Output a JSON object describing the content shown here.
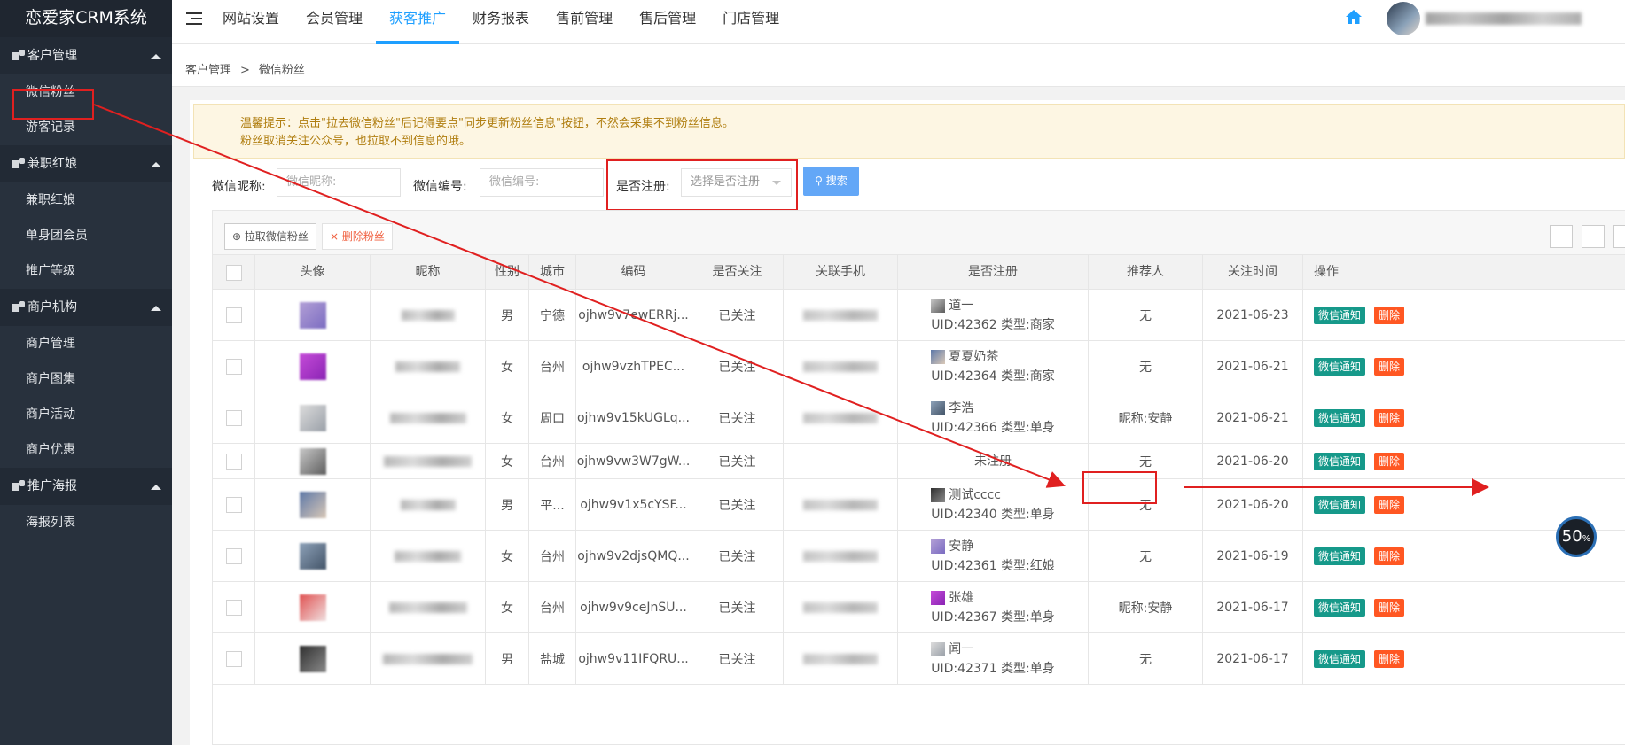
{
  "app": {
    "title": "恋爱家CRM系统"
  },
  "sidebar": {
    "groups": [
      {
        "label": "客户管理",
        "items": [
          "微信粉丝",
          "游客记录"
        ]
      },
      {
        "label": "兼职红娘",
        "items": [
          "兼职红娘",
          "单身团会员",
          "推广等级"
        ]
      },
      {
        "label": "商户机构",
        "items": [
          "商户管理",
          "商户图集",
          "商户活动",
          "商户优惠"
        ]
      },
      {
        "label": "推广海报",
        "items": [
          "海报列表"
        ]
      }
    ]
  },
  "topnav": {
    "items": [
      "网站设置",
      "会员管理",
      "获客推广",
      "财务报表",
      "售前管理",
      "售后管理",
      "门店管理"
    ],
    "active": "获客推广"
  },
  "breadcrumb": {
    "root": "客户管理",
    "sep": ">",
    "current": "微信粉丝"
  },
  "tip": {
    "line1": "温馨提示：点击\"拉去微信粉丝\"后记得要点\"同步更新粉丝信息\"按钮，不然会采集不到粉丝信息。",
    "line2": "粉丝取消关注公众号，也拉取不到信息的哦。"
  },
  "filters": {
    "nickname_label": "微信昵称:",
    "nickname_placeholder": "微信昵称:",
    "code_label": "微信编号:",
    "code_placeholder": "微信编号:",
    "registered_label": "是否注册:",
    "registered_placeholder": "选择是否注册",
    "search_label": "搜索"
  },
  "toolbar": {
    "pull_label": "拉取微信粉丝",
    "delete_label": "删除粉丝"
  },
  "table": {
    "columns": [
      "头像",
      "昵称",
      "性别",
      "城市",
      "编码",
      "是否关注",
      "关联手机",
      "是否注册",
      "推荐人",
      "关注时间",
      "操作"
    ],
    "rows": [
      {
        "gender": "男",
        "city": "宁德",
        "code": "ojhw9v7ewERRj...",
        "follow": "已关注",
        "reg_name": "道一",
        "reg_info": "UID:42362 类型:商家",
        "referrer": "无",
        "date": "2021-06-23"
      },
      {
        "gender": "女",
        "city": "台州",
        "code": "ojhw9vzhTPEC...",
        "follow": "已关注",
        "reg_name": "夏夏奶茶",
        "reg_info": "UID:42364 类型:商家",
        "referrer": "无",
        "date": "2021-06-21"
      },
      {
        "gender": "女",
        "city": "周口",
        "code": "ojhw9v15kUGLq...",
        "follow": "已关注",
        "reg_name": "李浩",
        "reg_info": "UID:42366 类型:单身",
        "referrer": "昵称:安静",
        "date": "2021-06-21"
      },
      {
        "gender": "女",
        "city": "台州",
        "code": "ojhw9vw3W7gW...",
        "follow": "已关注",
        "reg_name": "未注册",
        "reg_info": "",
        "referrer": "无",
        "date": "2021-06-20"
      },
      {
        "gender": "男",
        "city": "平...",
        "code": "ojhw9v1x5cYSF...",
        "follow": "已关注",
        "reg_name": "测试cccc",
        "reg_info": "UID:42340 类型:单身",
        "referrer": "无",
        "date": "2021-06-20"
      },
      {
        "gender": "女",
        "city": "台州",
        "code": "ojhw9v2djsQMQ...",
        "follow": "已关注",
        "reg_name": "安静",
        "reg_info": "UID:42361 类型:红娘",
        "referrer": "无",
        "date": "2021-06-19"
      },
      {
        "gender": "女",
        "city": "台州",
        "code": "ojhw9v9ceJnSU...",
        "follow": "已关注",
        "reg_name": "张雄",
        "reg_info": "UID:42367 类型:单身",
        "referrer": "昵称:安静",
        "date": "2021-06-17"
      },
      {
        "gender": "男",
        "city": "盐城",
        "code": "ojhw9v11IFQRU...",
        "follow": "已关注",
        "reg_name": "闻一",
        "reg_info": "UID:42371 类型:单身",
        "referrer": "无",
        "date": "2021-06-17"
      }
    ],
    "actions": {
      "notify": "微信通知",
      "delete": "删除"
    }
  },
  "cpu": {
    "value": "50",
    "unit": "%"
  },
  "colors": {
    "primary": "#1e9fff",
    "notify": "#16998a",
    "danger": "#ff5722",
    "sidebar": "#28313d",
    "annotation": "#e02020"
  }
}
